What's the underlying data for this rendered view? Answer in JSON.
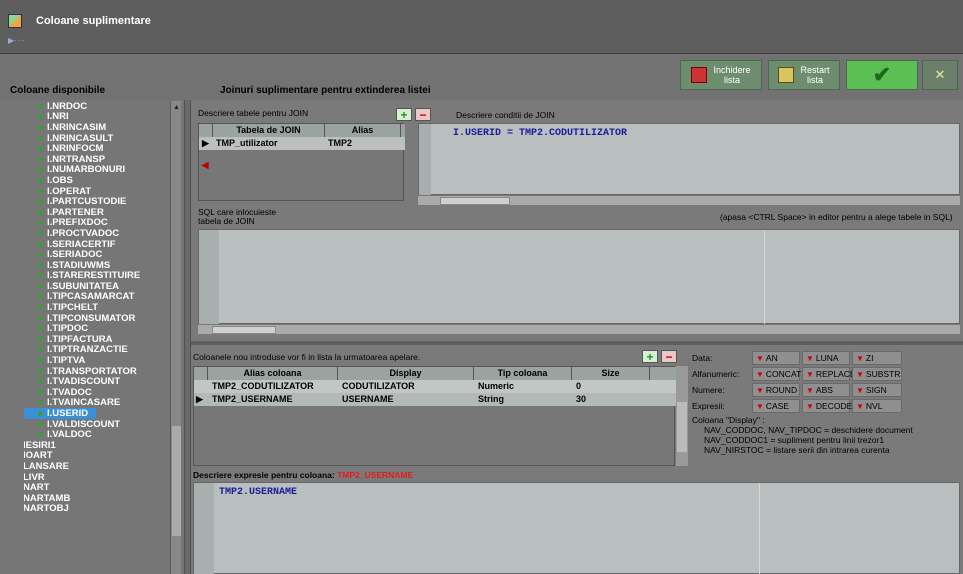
{
  "window": {
    "title": "Coloane suplimentare",
    "subtitle": "▶····"
  },
  "labels": {
    "available": "Coloane disponibile",
    "joins": "Joinuri suplimentare pentru extinderea listei",
    "join_tables": "Descriere tabele pentru JOIN",
    "join_conditions": "Descriere conditii de JOIN",
    "sql_line1": "SQL care inlocuieste",
    "sql_line2": "tabela de JOIN",
    "sql_hint": "(apasa <CTRL Space> in editor pentru a alege tabele in SQL)",
    "new_columns": "Coloanele nou introduse vor fi in lista la urmatoarea apelare.",
    "expr_prefix": "Descriere expresie pentru coloana:",
    "expr_column": "TMP2_USERNAME"
  },
  "toolbar": {
    "close_line1": "Inchidere",
    "close_line2": "lista",
    "restart_line1": "Restart",
    "restart_line2": "lista",
    "ok_glyph": "✔",
    "cancel_glyph": "✕"
  },
  "fields": [
    "I.NRDOC",
    "I.NRI",
    "I.NRINCASIM",
    "I.NRINCASULT",
    "I.NRINFOCM",
    "I.NRTRANSP",
    "I.NUMARBONURI",
    "I.OBS",
    "I.OPERAT",
    "I.PARTCUSTODIE",
    "I.PARTENER",
    "I.PREFIXDOC",
    "I.PROCTVADOC",
    "I.SERIACERTIF",
    "I.SERIADOC",
    "I.STADIUWMS",
    "I.STARERESTITUIRE",
    "I.SUBUNITATEA",
    "I.TIPCASAMARCAT",
    "I.TIPCHELT",
    "I.TIPCONSUMATOR",
    "I.TIPDOC",
    "I.TIPFACTURA",
    "I.TIPTRANZACTIE",
    "I.TIPTVA",
    "I.TRANSPORTATOR",
    "I.TVADISCOUNT",
    "I.TVADOC",
    "I.TVAINCASARE",
    "I.USERID",
    "I.VALDISCOUNT",
    "I.VALDOC"
  ],
  "top_fields": [
    "IESIRI1",
    "IOART",
    "LANSARE",
    "LIVR",
    "NART",
    "NARTAMB",
    "NARTOBJ"
  ],
  "join_grid": {
    "headers": [
      "Tabela de JOIN",
      "Alias"
    ],
    "row": {
      "table": "TMP_utilizator",
      "alias": "TMP2"
    }
  },
  "join_condition": "I.USERID = TMP2.CODUTILIZATOR",
  "cols_grid": {
    "headers": [
      "Alias coloana",
      "Display",
      "Tip coloana",
      "Size"
    ],
    "rows": [
      {
        "alias": "TMP2_CODUTILIZATOR",
        "display": "CODUTILIZATOR",
        "type": "Numeric",
        "size": "0"
      },
      {
        "alias": "TMP2_USERNAME",
        "display": "USERNAME",
        "type": "String",
        "size": "30"
      }
    ]
  },
  "functions": {
    "data": {
      "caption": "Data:",
      "items": [
        "AN",
        "LUNA",
        "ZI"
      ]
    },
    "alfa": {
      "caption": "Alfanumeric:",
      "items": [
        "CONCAT",
        "REPLACE",
        "SUBSTR"
      ]
    },
    "numere": {
      "caption": "Numere:",
      "items": [
        "ROUND",
        "ABS",
        "SIGN"
      ]
    },
    "expresii": {
      "caption": "Expresii:",
      "items": [
        "CASE",
        "DECODE",
        "NVL"
      ]
    }
  },
  "notes": {
    "title": "Coloana \"Display\" :",
    "line1": "NAV_CODDOC, NAV_TIPDOC = deschidere document",
    "line2": "NAV_CODDOC1 = supliment pentru linii trezor1",
    "line3": "NAV_NIRSTOC = listare serii din intrarea curenta"
  },
  "expression": "TMP2.USERNAME",
  "colors": {
    "selected": "#3b8fd6",
    "accent_red": "#e21c1c",
    "code_blue": "#1b1b9a",
    "ok_green": "#5bbf53"
  }
}
